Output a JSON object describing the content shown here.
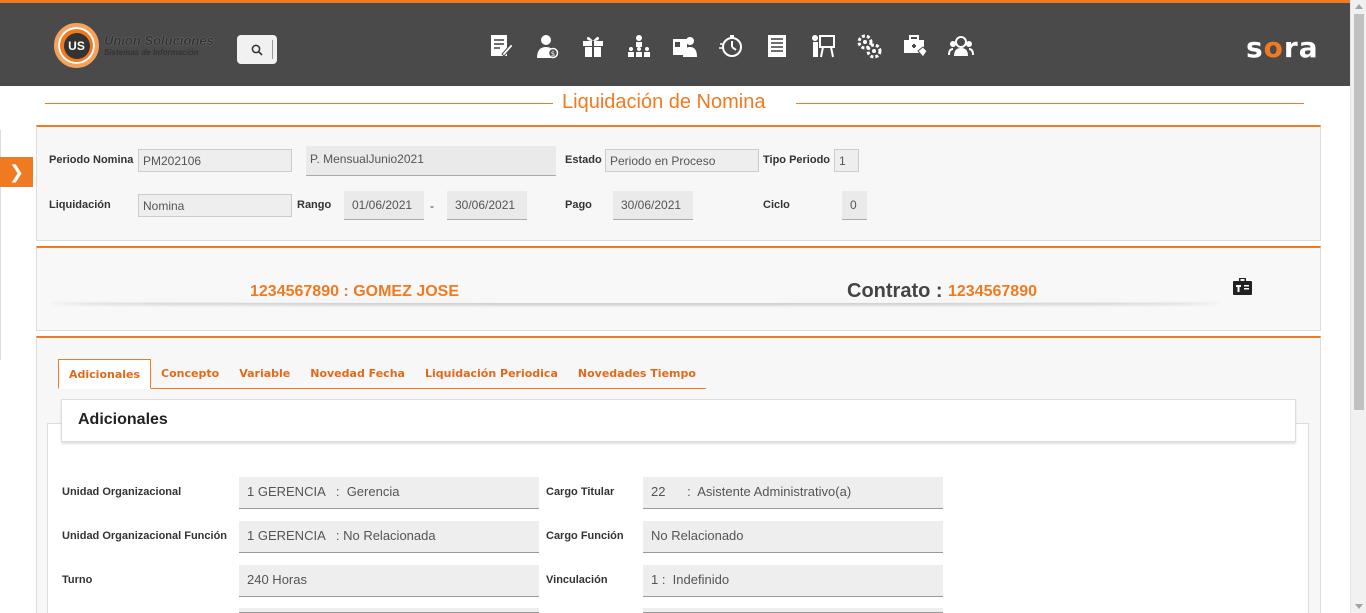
{
  "header": {
    "logo_mark": "US",
    "logo_title": "Unión Soluciones",
    "logo_subtitle": "Sistemas de Información",
    "brand_left": "s",
    "brand_o": "o",
    "brand_right": "ra",
    "nav_icons": [
      "document-edit-icon",
      "user-money-icon",
      "gift-icon",
      "hierarchy-icon",
      "users-id-icon",
      "stopwatch-icon",
      "form-icon",
      "presentation-icon",
      "gears-icon",
      "medical-bag-icon",
      "staff-icon"
    ],
    "accent": "#f07a22",
    "bar_color": "#4a4a4a"
  },
  "page": {
    "title": "Liquidación de Nomina"
  },
  "periodo": {
    "periodo_label": "Periodo Nomina",
    "periodo_value": "PM202106",
    "periodo_desc": "P. MensualJunio2021",
    "estado_label": "Estado",
    "estado_value": "Periodo en Proceso",
    "tipo_label": "Tipo Periodo",
    "tipo_value": "1",
    "liquidacion_label": "Liquidación",
    "liquidacion_value": "Nomina",
    "rango_label": "Rango",
    "rango_from": "01/06/2021",
    "rango_sep": "-",
    "rango_to": "30/06/2021",
    "pago_label": "Pago",
    "pago_value": "30/06/2021",
    "ciclo_label": "Ciclo",
    "ciclo_value": "0"
  },
  "empleado": {
    "name": "1234567890 : GOMEZ JOSE",
    "contrato_label": "Contrato :",
    "contrato_value": "1234567890"
  },
  "tabs": [
    {
      "label": "Adicionales",
      "active": true
    },
    {
      "label": "Concepto"
    },
    {
      "label": "Variable"
    },
    {
      "label": "Novedad Fecha"
    },
    {
      "label": "Liquidación Periodica"
    },
    {
      "label": "Novedades Tiempo"
    }
  ],
  "adicionales": {
    "title": "Adicionales",
    "unidad_org_label": "Unidad Organizacional",
    "unidad_org_value": "1 GERENCIA   :  Gerencia",
    "cargo_titular_label": "Cargo Titular",
    "cargo_titular_value": "22      :  Asistente Administrativo(a)",
    "unidad_fun_label": "Unidad Organizacional Función",
    "unidad_fun_value": "1 GERENCIA   : No Relacionada",
    "cargo_funcion_label": "Cargo Función",
    "cargo_funcion_value": "No Relacionado",
    "turno_label": "Turno",
    "turno_value": "240 Horas",
    "vinculacion_label": "Vinculación",
    "vinculacion_value": "1 :  Indefinido"
  }
}
